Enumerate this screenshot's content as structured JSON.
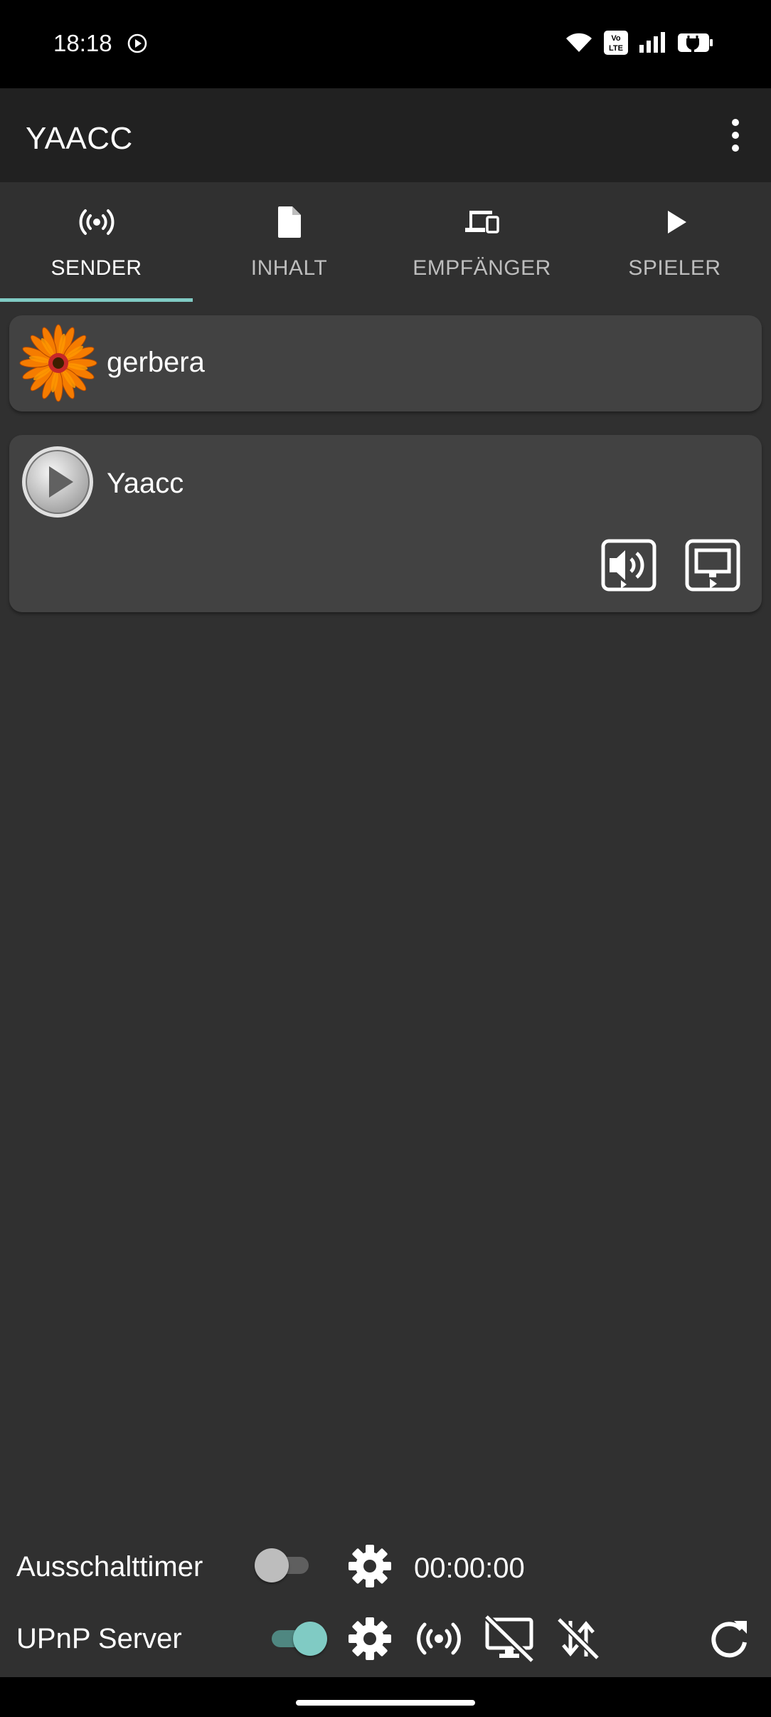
{
  "status_bar": {
    "time": "18:18",
    "icons": [
      "screen-record-icon",
      "wifi-icon",
      "volte-icon",
      "signal-icon",
      "battery-charging-icon"
    ],
    "volte_label": "Vo LTE"
  },
  "app_bar": {
    "title": "YAACC",
    "menu_icon": "more-vert-icon"
  },
  "tabs": [
    {
      "label": "SENDER",
      "icon": "broadcast-icon",
      "active": true
    },
    {
      "label": "INHALT",
      "icon": "file-icon",
      "active": false
    },
    {
      "label": "EMPFÄNGER",
      "icon": "devices-icon",
      "active": false
    },
    {
      "label": "SPIELER",
      "icon": "play-icon",
      "active": false
    }
  ],
  "servers": [
    {
      "name": "gerbera",
      "icon": "gerbera-flower-icon"
    },
    {
      "name": "Yaacc",
      "icon": "yaacc-play-icon",
      "actions": [
        "audio-renderer-icon",
        "video-renderer-icon"
      ]
    }
  ],
  "bottom": {
    "timer": {
      "label": "Ausschalttimer",
      "enabled": false,
      "value": "00:00:00",
      "settings_icon": "gear-icon"
    },
    "upnp": {
      "label": "UPnP Server",
      "enabled": true,
      "icons": [
        "gear-icon",
        "broadcast-icon",
        "desktop-off-icon",
        "sync-off-icon",
        "refresh-icon"
      ]
    }
  },
  "colors": {
    "background": "#303030",
    "app_bar": "#212121",
    "card": "#424242",
    "accent": "#80cbc4"
  }
}
